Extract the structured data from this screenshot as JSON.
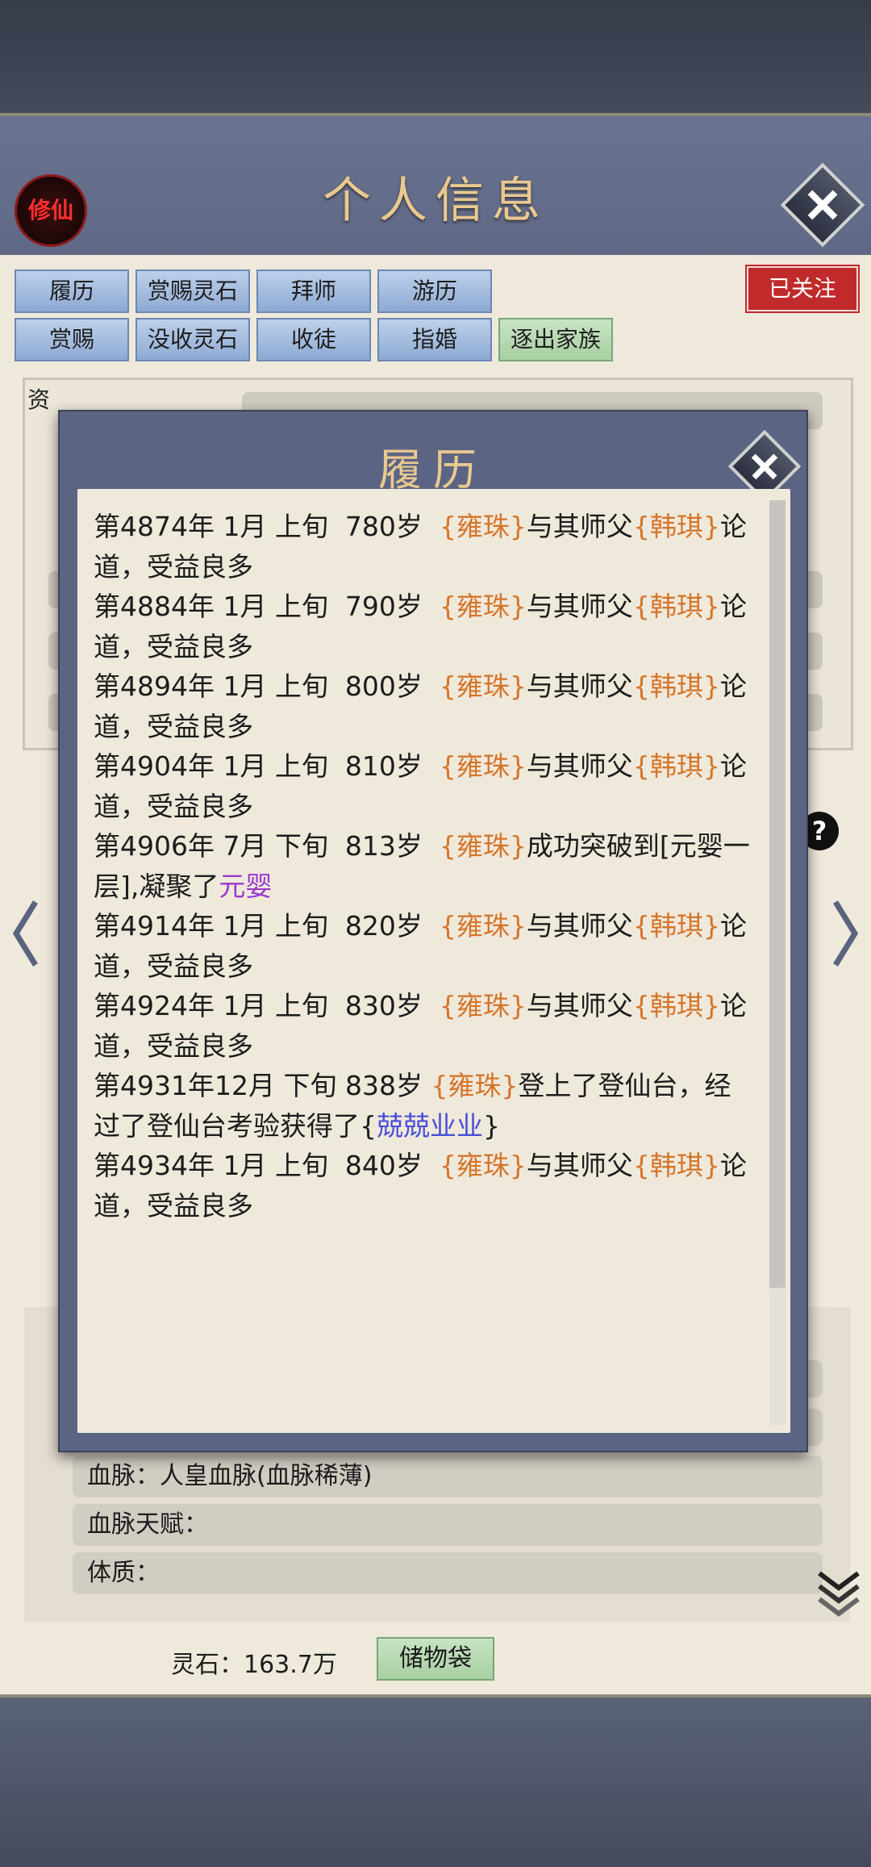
{
  "header": {
    "title": "个人信息",
    "seal": "修仙"
  },
  "tabs": {
    "row1": [
      "履历",
      "赏赐灵石",
      "拜师",
      "游历"
    ],
    "row2": [
      "赏赐",
      "没收灵石",
      "收徒",
      "指婚",
      "逐出家族"
    ]
  },
  "follow_button": "已关注",
  "aptitude_label": "资",
  "details": [
    {
      "label": "血脉：",
      "value": "人皇血脉(血脉稀薄)"
    },
    {
      "label": "血脉天赋：",
      "value": ""
    },
    {
      "label": "体质：",
      "value": ""
    }
  ],
  "footer": {
    "stones_label": "灵石：",
    "stones_value": "163.7万",
    "bag_button": "储物袋"
  },
  "modal": {
    "title": "履历",
    "entries": [
      [
        {
          "t": "第4874年 1月 上旬  780岁  "
        },
        {
          "t": "{雍珠}",
          "c": "n"
        },
        {
          "t": "与其师父"
        },
        {
          "t": "{韩琪}",
          "c": "n"
        },
        {
          "t": "论道，受益良多"
        }
      ],
      [
        {
          "t": "第4884年 1月 上旬  790岁  "
        },
        {
          "t": "{雍珠}",
          "c": "n"
        },
        {
          "t": "与其师父"
        },
        {
          "t": "{韩琪}",
          "c": "n"
        },
        {
          "t": "论道，受益良多"
        }
      ],
      [
        {
          "t": "第4894年 1月 上旬  800岁  "
        },
        {
          "t": "{雍珠}",
          "c": "n"
        },
        {
          "t": "与其师父"
        },
        {
          "t": "{韩琪}",
          "c": "n"
        },
        {
          "t": "论道，受益良多"
        }
      ],
      [
        {
          "t": "第4904年 1月 上旬  810岁  "
        },
        {
          "t": "{雍珠}",
          "c": "n"
        },
        {
          "t": "与其师父"
        },
        {
          "t": "{韩琪}",
          "c": "n"
        },
        {
          "t": "论道，受益良多"
        }
      ],
      [
        {
          "t": "第4906年 7月 下旬  813岁  "
        },
        {
          "t": "{雍珠}",
          "c": "n"
        },
        {
          "t": "成功突破到[元婴一层],凝聚了"
        },
        {
          "t": "元婴",
          "c": "p"
        }
      ],
      [
        {
          "t": "第4914年 1月 上旬  820岁  "
        },
        {
          "t": "{雍珠}",
          "c": "n"
        },
        {
          "t": "与其师父"
        },
        {
          "t": "{韩琪}",
          "c": "n"
        },
        {
          "t": "论道，受益良多"
        }
      ],
      [
        {
          "t": "第4924年 1月 上旬  830岁  "
        },
        {
          "t": "{雍珠}",
          "c": "n"
        },
        {
          "t": "与其师父"
        },
        {
          "t": "{韩琪}",
          "c": "n"
        },
        {
          "t": "论道，受益良多"
        }
      ],
      [
        {
          "t": "第4931年12月 下旬 838岁 "
        },
        {
          "t": "{雍珠}",
          "c": "n"
        },
        {
          "t": "登上了登仙台，经过了登仙台考验获得了{"
        },
        {
          "t": "兢兢业业",
          "c": "b"
        },
        {
          "t": "}"
        }
      ],
      [
        {
          "t": "第4934年 1月 上旬  840岁  "
        },
        {
          "t": "{雍珠}",
          "c": "n"
        },
        {
          "t": "与其师父"
        },
        {
          "t": "{韩琪}",
          "c": "n"
        },
        {
          "t": "论道，受益良多"
        }
      ]
    ]
  }
}
